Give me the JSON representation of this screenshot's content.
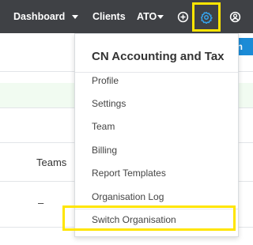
{
  "navbar": {
    "dashboard_label": "Dashboard",
    "clients_label": "Clients",
    "ato_label": "ATO",
    "background_color": "#3f4145",
    "icons": [
      "chevron-down-icon",
      "plus-circle-icon",
      "gear-icon",
      "user-circle-icon"
    ]
  },
  "page": {
    "teams_label": "Teams",
    "dash_value": "–",
    "action_button_label": "+ In",
    "highlight_row_color": "#f1fbf1",
    "button_color": "#1b8bd6"
  },
  "dropdown": {
    "title": "CN Accounting and Tax",
    "items": [
      {
        "label": "Profile"
      },
      {
        "label": "Settings"
      },
      {
        "label": "Team"
      },
      {
        "label": "Billing"
      },
      {
        "label": "Report Templates"
      },
      {
        "label": "Organisation Log"
      },
      {
        "label": "Switch Organisation"
      }
    ]
  },
  "annotation": {
    "highlight_color": "#ffe500"
  }
}
